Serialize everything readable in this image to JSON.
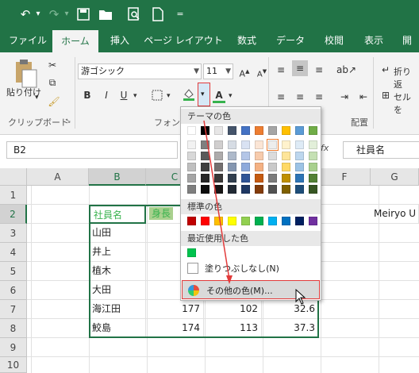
{
  "quick_access": {
    "undo_icon": "undo-icon",
    "redo_icon": "redo-icon",
    "save_icon": "save-icon",
    "open_icon": "folder-icon",
    "preview_icon": "print-preview-icon",
    "new_icon": "new-document-icon",
    "customize_icon": "dropdown-arrow-icon"
  },
  "tabs": [
    "ファイル",
    "ホーム",
    "挿入",
    "ページ レイアウト",
    "数式",
    "データ",
    "校閲",
    "表示",
    "開"
  ],
  "active_tab": "ホーム",
  "ribbon": {
    "paste_label": "貼り付け",
    "clipboard_label": "クリップボード",
    "font_name": "游ゴシック",
    "font_size": "11",
    "font_group_label": "フォント",
    "bold": "B",
    "italic": "I",
    "underline": "U",
    "font_color_letter": "A",
    "wrap_label": "折り返",
    "merge_label": "セルを",
    "align_group_label": "配置"
  },
  "formula_bar": {
    "name_box": "B2",
    "fx": "fx",
    "content": "社員名"
  },
  "sheet": {
    "columns": [
      "A",
      "B",
      "C",
      "D",
      "E",
      "F",
      "G"
    ],
    "rows": [
      "1",
      "2",
      "3",
      "4",
      "5",
      "6",
      "7",
      "8",
      "9",
      "10"
    ],
    "cells": {
      "B2": "社員名",
      "C2": "身長",
      "B3": "山田",
      "B4": "井上",
      "B5": "植木",
      "B6": "大田",
      "B7": "海江田",
      "C7": "177",
      "D7": "102",
      "E7": "32.6",
      "B8": "鮫島",
      "C8": "174",
      "D8": "113",
      "E8": "37.3",
      "G2": "Meiryo U"
    }
  },
  "color_dropdown": {
    "theme_header": "テーマの色",
    "standard_header": "標準の色",
    "recent_header": "最近使用した色",
    "no_fill_label": "塗りつぶしなし(N)",
    "more_colors_label": "その他の色(M)...",
    "theme_colors": [
      "#ffffff",
      "#000000",
      "#e7e6e6",
      "#44546a",
      "#4472c4",
      "#ed7d31",
      "#a5a5a5",
      "#ffc000",
      "#5b9bd5",
      "#70ad47"
    ],
    "theme_shades": [
      [
        "#f2f2f2",
        "#7f7f7f",
        "#d0cece",
        "#d6dce4",
        "#d9e2f3",
        "#fbe5d5",
        "#ededed",
        "#fff2cc",
        "#deebf6",
        "#e2efd9"
      ],
      [
        "#d8d8d8",
        "#595959",
        "#aeabab",
        "#adb9ca",
        "#b4c6e7",
        "#f7cbac",
        "#dbdbdb",
        "#fee599",
        "#bdd7ee",
        "#c5e0b3"
      ],
      [
        "#bfbfbf",
        "#3f3f3f",
        "#757070",
        "#8496b0",
        "#8eaadb",
        "#f4b183",
        "#c9c9c9",
        "#ffd965",
        "#9cc3e5",
        "#a8d08d"
      ],
      [
        "#a5a5a5",
        "#262626",
        "#3a3838",
        "#323f4f",
        "#2f5496",
        "#c55a11",
        "#7b7b7b",
        "#bf9000",
        "#2e75b5",
        "#538135"
      ],
      [
        "#7f7f7f",
        "#0c0c0c",
        "#171616",
        "#222a35",
        "#1f3864",
        "#833c0b",
        "#525252",
        "#7f6000",
        "#1e4e79",
        "#375623"
      ]
    ],
    "standard_colors": [
      "#c00000",
      "#ff0000",
      "#ffc000",
      "#ffff00",
      "#92d050",
      "#00b050",
      "#00b0f0",
      "#0070c0",
      "#002060",
      "#7030a0"
    ],
    "recent_colors": [
      "#00c34e"
    ],
    "highlight_color": "#e23b3b"
  },
  "colors": {
    "excel_green": "#217346",
    "cell_green_text": "#37b24d",
    "selected_fill": "#a9d08e"
  }
}
